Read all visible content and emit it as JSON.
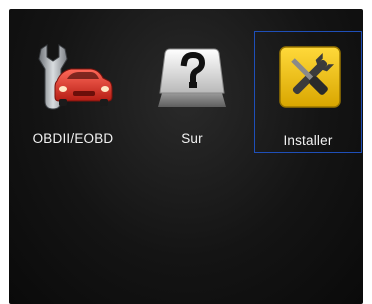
{
  "menu": {
    "items": [
      {
        "label": "OBDII/EOBD",
        "icon": "wrench-car-icon",
        "selected": false
      },
      {
        "label": "Sur",
        "icon": "question-key-icon",
        "selected": false
      },
      {
        "label": "Installer",
        "icon": "tools-icon",
        "selected": true
      }
    ]
  },
  "colors": {
    "selection_border": "#1f4fb8",
    "background": "#141414",
    "car": "#e23b2e",
    "tools_tile": "#f2c200"
  }
}
